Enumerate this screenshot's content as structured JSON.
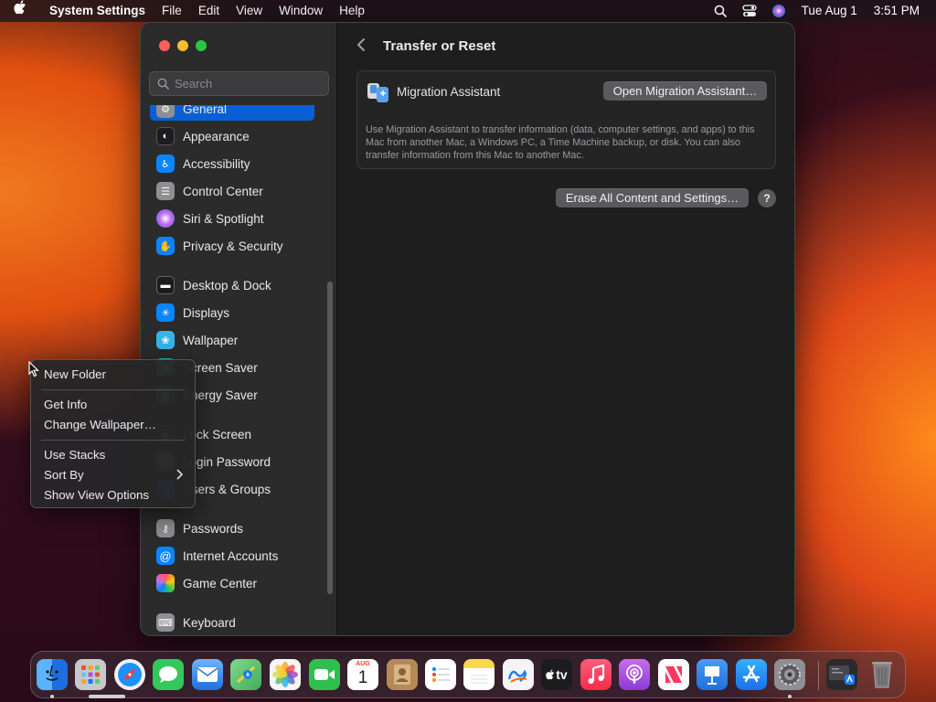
{
  "menubar": {
    "app_name": "System Settings",
    "menus": [
      "File",
      "Edit",
      "View",
      "Window",
      "Help"
    ],
    "date": "Tue Aug 1",
    "time": "3:51 PM"
  },
  "search": {
    "placeholder": "Search"
  },
  "sidebar": {
    "items": [
      {
        "label": "General",
        "icon": "gear-icon",
        "color": "#8e8e93",
        "selected": true
      },
      {
        "label": "Appearance",
        "icon": "appearance-icon",
        "color": "#1c1c1e"
      },
      {
        "label": "Accessibility",
        "icon": "accessibility-icon",
        "color": "#0a84ff"
      },
      {
        "label": "Control Center",
        "icon": "control-center-icon",
        "color": "#8e8e93"
      },
      {
        "label": "Siri & Spotlight",
        "icon": "siri-icon",
        "color": "#6a3cc7"
      },
      {
        "label": "Privacy & Security",
        "icon": "hand-icon",
        "color": "#0a84ff"
      },
      {
        "label": "Desktop & Dock",
        "icon": "dock-icon",
        "color": "#1c1c1e"
      },
      {
        "label": "Displays",
        "icon": "sun-icon",
        "color": "#0a84ff"
      },
      {
        "label": "Wallpaper",
        "icon": "wallpaper-icon",
        "color": "#38b3e8"
      },
      {
        "label": "Screen Saver",
        "icon": "screen-saver-icon",
        "color": "#34c1c8"
      },
      {
        "label": "Energy Saver",
        "icon": "battery-icon",
        "color": "#30b34c"
      },
      {
        "label": "Lock Screen",
        "icon": "lock-icon",
        "color": "#1c1c1e"
      },
      {
        "label": "Login Password",
        "icon": "key-icon",
        "color": "#8e8e93"
      },
      {
        "label": "Users & Groups",
        "icon": "users-icon",
        "color": "#0a84ff"
      },
      {
        "label": "Passwords",
        "icon": "key-icon",
        "color": "#8e8e93"
      },
      {
        "label": "Internet Accounts",
        "icon": "at-icon",
        "color": "#0a84ff"
      },
      {
        "label": "Game Center",
        "icon": "game-center-icon",
        "color": "#e0e0e0"
      },
      {
        "label": "Keyboard",
        "icon": "keyboard-icon",
        "color": "#8e8e93"
      }
    ]
  },
  "main": {
    "title": "Transfer or Reset",
    "migration": {
      "label": "Migration Assistant",
      "button": "Open Migration Assistant…",
      "description": "Use Migration Assistant to transfer information (data, computer settings, and apps) to this Mac from another Mac, a Windows PC, a Time Machine backup, or disk. You can also transfer information from this Mac to another Mac."
    },
    "erase_button": "Erase All Content and Settings…",
    "help": "?"
  },
  "context_menu": {
    "items": [
      "New Folder",
      "Get Info",
      "Change Wallpaper…",
      "Use Stacks",
      "Sort By",
      "Show View Options"
    ]
  },
  "dock": {
    "calendar_month": "AUG",
    "calendar_day": "1",
    "tv_label": "tv",
    "apps": [
      {
        "name": "Finder",
        "icon": "finder-icon",
        "color": "#2b8ef0",
        "running": true
      },
      {
        "name": "Launchpad",
        "icon": "launchpad-icon",
        "color": "#c8c8cc",
        "running": true
      },
      {
        "name": "Safari",
        "icon": "safari-icon",
        "color": "#1e90ff"
      },
      {
        "name": "Messages",
        "icon": "messages-icon",
        "color": "#34c759"
      },
      {
        "name": "Mail",
        "icon": "mail-icon",
        "color": "#3a8dde"
      },
      {
        "name": "Maps",
        "icon": "maps-icon",
        "color": "#5cc26e"
      },
      {
        "name": "Photos",
        "icon": "photos-icon",
        "color": "#f5f5f5"
      },
      {
        "name": "FaceTime",
        "icon": "facetime-icon",
        "color": "#2fbf4f"
      },
      {
        "name": "Calendar",
        "icon": "calendar-icon",
        "color": "#ffffff"
      },
      {
        "name": "Contacts",
        "icon": "contacts-icon",
        "color": "#b68a56"
      },
      {
        "name": "Reminders",
        "icon": "reminders-icon",
        "color": "#ffffff"
      },
      {
        "name": "Notes",
        "icon": "notes-icon",
        "color": "#f6d84a"
      },
      {
        "name": "Freeform",
        "icon": "freeform-icon",
        "color": "#f4f4f4"
      },
      {
        "name": "TV",
        "icon": "tv-icon",
        "color": "#1c1c1e"
      },
      {
        "name": "Music",
        "icon": "music-icon",
        "color": "#fa3c52"
      },
      {
        "name": "Podcasts",
        "icon": "podcasts-icon",
        "color": "#9b4ee0"
      },
      {
        "name": "News",
        "icon": "news-icon",
        "color": "#ffffff"
      },
      {
        "name": "Keynote",
        "icon": "keynote-icon",
        "color": "#2e7de6"
      },
      {
        "name": "App Store",
        "icon": "app-store-icon",
        "color": "#2d8cf0"
      },
      {
        "name": "System Settings",
        "icon": "system-settings-icon",
        "color": "#8e8e93",
        "running": true
      },
      {
        "name": "Downloads",
        "icon": "downloads-folder-icon",
        "color": "#3a3a3c"
      },
      {
        "name": "Trash",
        "icon": "trash-icon",
        "color": "#7a7a7e"
      }
    ]
  }
}
